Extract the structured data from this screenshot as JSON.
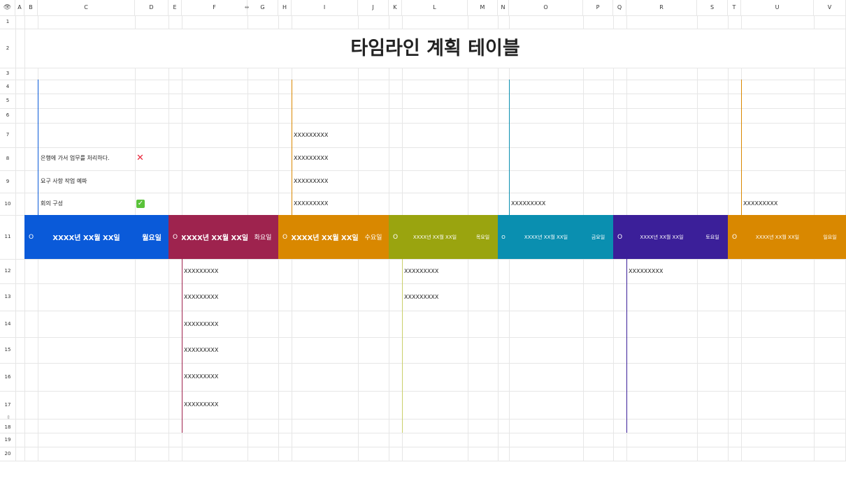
{
  "title": "타임라인 계획 테이블",
  "columns": [
    "A",
    "B",
    "C",
    "D",
    "E",
    "F",
    "G",
    "H",
    "I",
    "J",
    "K",
    "L",
    "M",
    "N",
    "O",
    "P",
    "Q",
    "R",
    "S",
    "T",
    "U",
    "V"
  ],
  "rows": [
    "1",
    "2",
    "3",
    "4",
    "5",
    "6",
    "7",
    "8",
    "9",
    "10",
    "11",
    "12",
    "13",
    "14",
    "15",
    "16",
    "17",
    "18",
    "19",
    "20"
  ],
  "icons": {
    "header_corner": "eye-icon",
    "column_resize": "column-resize-icon",
    "row_resize": "row-resize-icon"
  },
  "tasks": [
    {
      "label": "은행에 가서 업무를 처리하다.",
      "status": "cross-mark-icon"
    },
    {
      "label": "요구 사항 작업 예파",
      "status": ""
    },
    {
      "label": "회의 구성",
      "status": "check-mark-icon"
    }
  ],
  "bands": [
    {
      "marker": "O",
      "date": "XXXX년 XX월 XX일",
      "day": "월요일",
      "color": "#0a5ad9"
    },
    {
      "marker": "O",
      "date": "XXXX년 XX월 XX일",
      "day": "화요일",
      "color": "#9e234e"
    },
    {
      "marker": "O",
      "date": "XXXX년 XX월 XX일",
      "day": "수요일",
      "color": "#d98800"
    },
    {
      "marker": "O",
      "date": "XXXX년 XX월 XX일",
      "day": "목요일",
      "color": "#9aa40f"
    },
    {
      "marker": "O",
      "date": "XXXX년 XX월 XX일",
      "day": "금요일",
      "color": "#0a8fb0"
    },
    {
      "marker": "O",
      "date": "XXXX년 XX월 XX일",
      "day": "토요일",
      "color": "#3b1f99"
    },
    {
      "marker": "O",
      "date": "XXXX년 XX월 XX일",
      "day": "일요일",
      "color": "#d98800"
    }
  ],
  "entry_text": "XXXXXXXXX"
}
